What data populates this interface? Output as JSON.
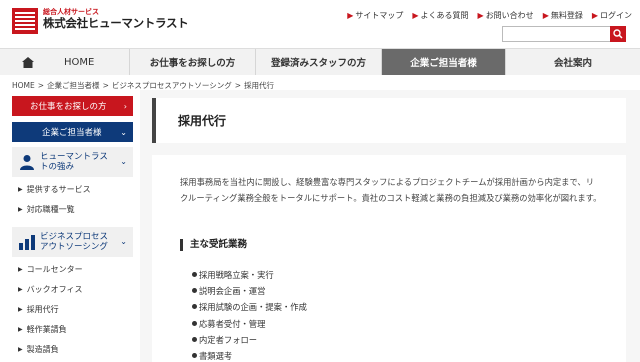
{
  "header": {
    "logo_sub": "総合人材サービス",
    "logo_main": "株式会社ヒューマントラスト",
    "utility_links": [
      "サイトマップ",
      "よくある質問",
      "お問い合わせ",
      "無料登録",
      "ログイン"
    ],
    "search_placeholder": ""
  },
  "nav": {
    "items": [
      "HOME",
      "お仕事をお探しの方",
      "登録済みスタッフの方",
      "企業ご担当者様",
      "会社案内"
    ],
    "active": "企業ご担当者様"
  },
  "breadcrumb": [
    "HOME",
    "企業ご担当者様",
    "ビジネスプロセスアウトソーシング",
    "採用代行"
  ],
  "sidebar": {
    "job_seeker_button": "お仕事をお探しの方",
    "company_button": "企業ご担当者様",
    "group1": {
      "line1": "ヒューマントラス",
      "line2": "トの強み"
    },
    "group1_links": [
      "提供するサービス",
      "対応職種一覧"
    ],
    "group2": {
      "line1": "ビジネスプロセス",
      "line2": "アウトソーシング"
    },
    "group2_links": [
      "コールセンター",
      "バックオフィス",
      "採用代行",
      "軽作業請負",
      "製造請負"
    ]
  },
  "main": {
    "title": "採用代行",
    "intro": "採用事務局を当社内に開設し、経験豊富な専門スタッフによるプロジェクトチームが採用計画から内定まで、リクルーティング業務全般をトータルにサポート。貴社のコスト軽減と業務の負担減及び業務の効率化が図れます。",
    "section_heading": "主な受託業務",
    "services": [
      "採用戦略立案・実行",
      "説明会企画・運営",
      "採用試験の企画・提案・作成",
      "応募者受付・管理",
      "内定者フォロー",
      "書類選考"
    ]
  },
  "colors": {
    "brand_red": "#c8161e",
    "navy": "#0e3a7a",
    "nav_active": "#6a6a6a"
  }
}
